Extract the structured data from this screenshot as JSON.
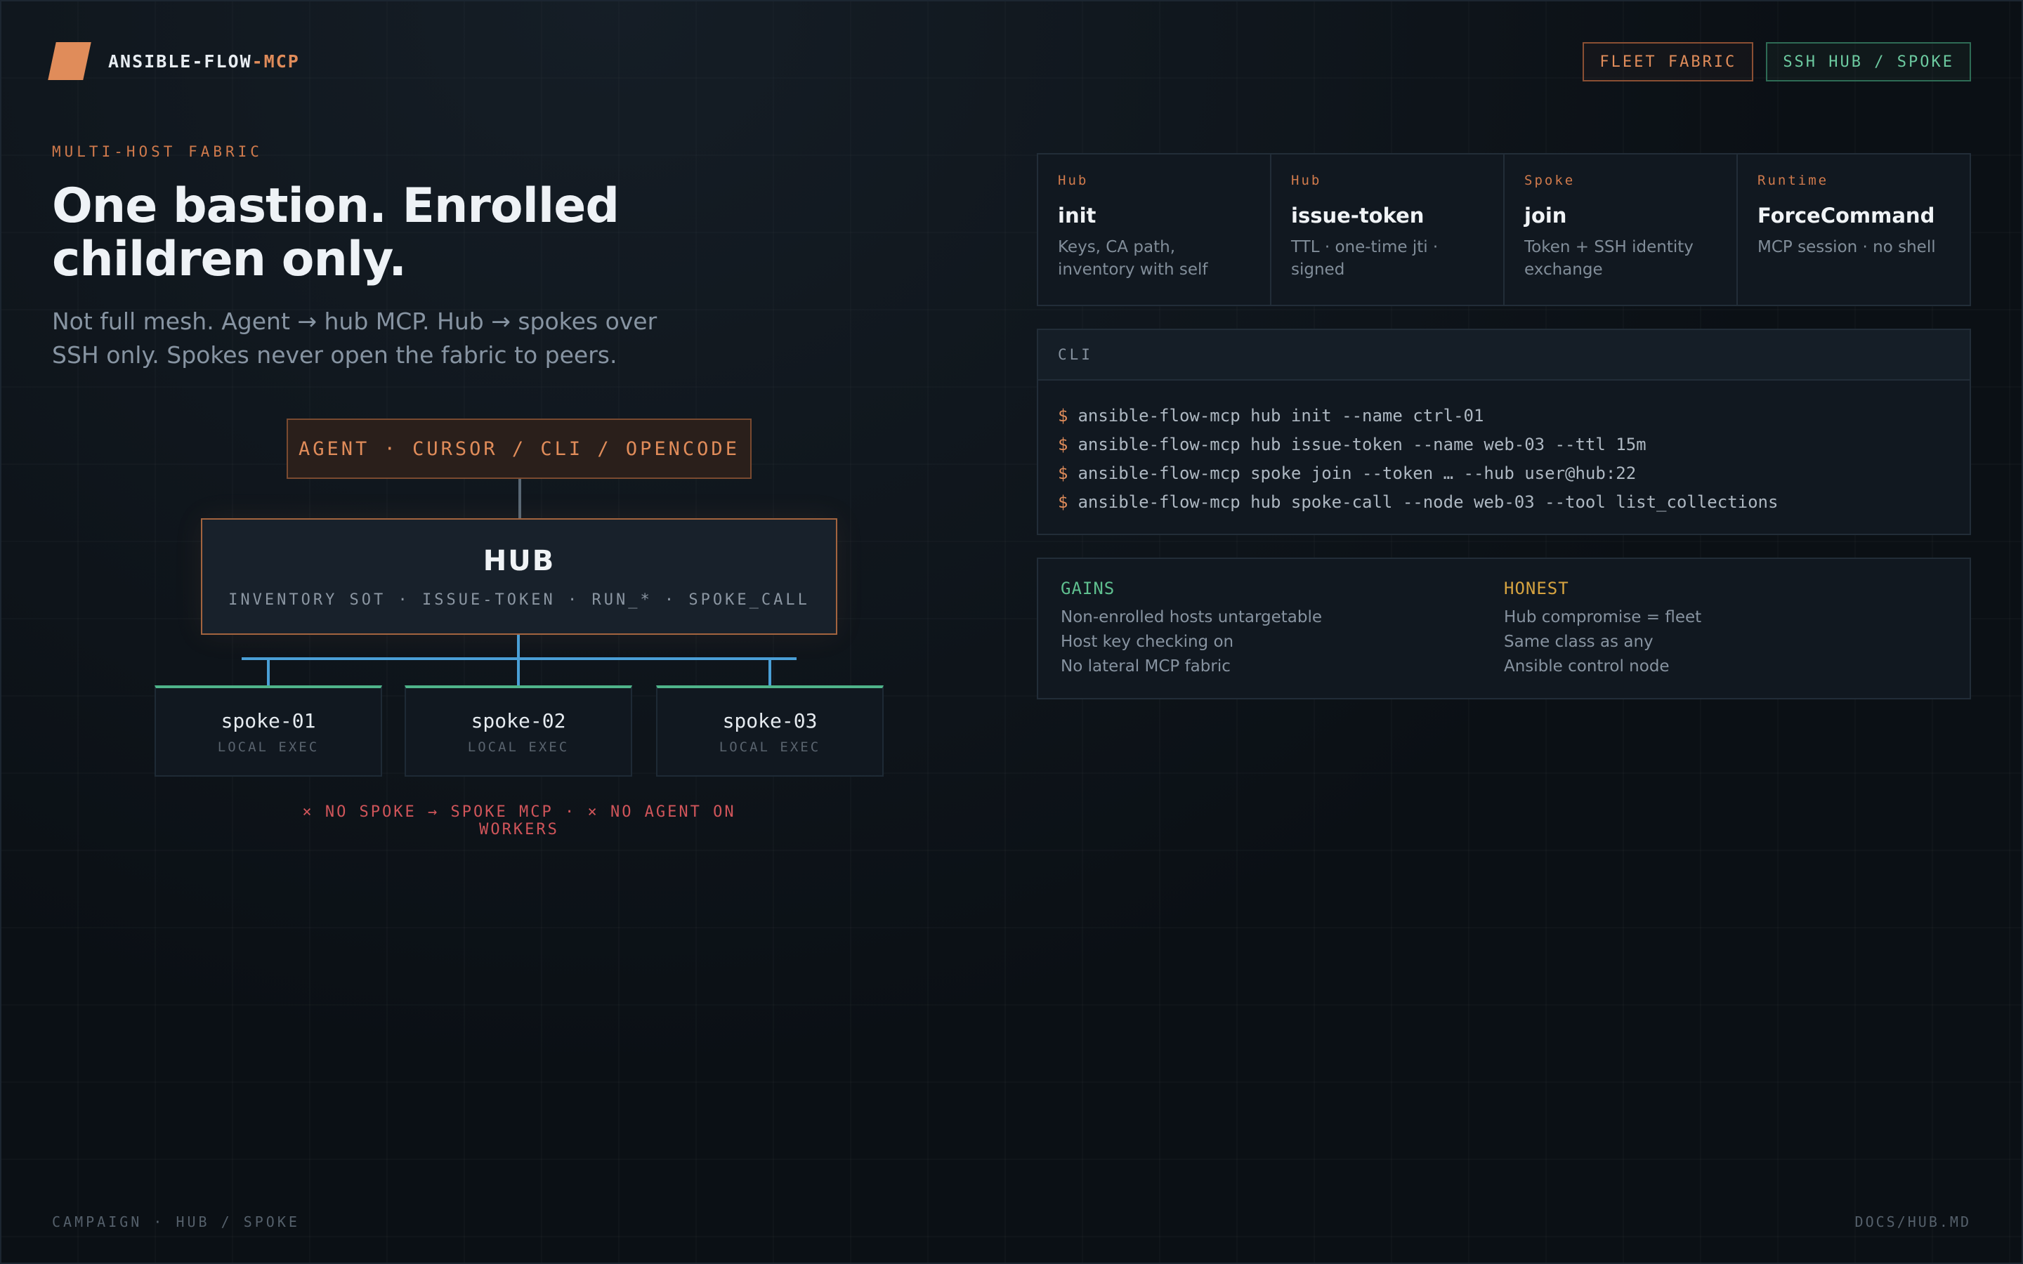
{
  "brand": {
    "name": "ANSIBLE-FLOW",
    "suffix": "-MCP"
  },
  "tags": {
    "fleet": "FLEET FABRIC",
    "ssh": "SSH HUB / SPOKE"
  },
  "hero": {
    "eyebrow": "MULTI-HOST FABRIC",
    "headline": "One bastion. Enrolled children only.",
    "subhead": "Not full mesh. Agent → hub MCP. Hub → spokes over SSH only. Spokes never open the fabric to peers."
  },
  "diagram": {
    "agent": "AGENT · CURSOR / CLI / OPENCODE",
    "hub_title": "HUB",
    "hub_sub": "INVENTORY SOT · ISSUE-TOKEN · RUN_* · SPOKE_CALL",
    "spokes": [
      {
        "name": "spoke-01",
        "sub": "LOCAL EXEC"
      },
      {
        "name": "spoke-02",
        "sub": "LOCAL EXEC"
      },
      {
        "name": "spoke-03",
        "sub": "LOCAL EXEC"
      }
    ],
    "warning": "× NO SPOKE → SPOKE MCP · × NO AGENT ON WORKERS"
  },
  "cards": [
    {
      "kind": "Hub",
      "title": "init",
      "desc": "Keys, CA path, inventory with self"
    },
    {
      "kind": "Hub",
      "title": "issue-token",
      "desc": "TTL · one-time jti · signed"
    },
    {
      "kind": "Spoke",
      "title": "join",
      "desc": "Token + SSH identity exchange"
    },
    {
      "kind": "Runtime",
      "title": "ForceCommand",
      "desc": "MCP session · no shell"
    }
  ],
  "cli": {
    "header": "CLI",
    "prompt": "$",
    "lines": [
      "ansible-flow-mcp hub init --name ctrl-01",
      "ansible-flow-mcp hub issue-token --name web-03 --ttl 15m",
      "ansible-flow-mcp spoke join --token … --hub user@hub:22",
      "ansible-flow-mcp hub spoke-call --node web-03 --tool list_collections"
    ]
  },
  "gains": {
    "gains_title": "GAINS",
    "gains_items": [
      "Non-enrolled hosts untargetable",
      "Host key checking on",
      "No lateral MCP fabric"
    ],
    "honest_title": "HONEST",
    "honest_items": [
      "Hub compromise = fleet",
      "Same class as any",
      "Ansible control node"
    ]
  },
  "footer": {
    "left": "CAMPAIGN · HUB / SPOKE",
    "right": "DOCS/HUB.MD"
  },
  "colors": {
    "accent_orange": "#e08c5a",
    "accent_green": "#4fb48a",
    "connector_blue": "#4a9fd6",
    "warning_red": "#d0555a"
  }
}
